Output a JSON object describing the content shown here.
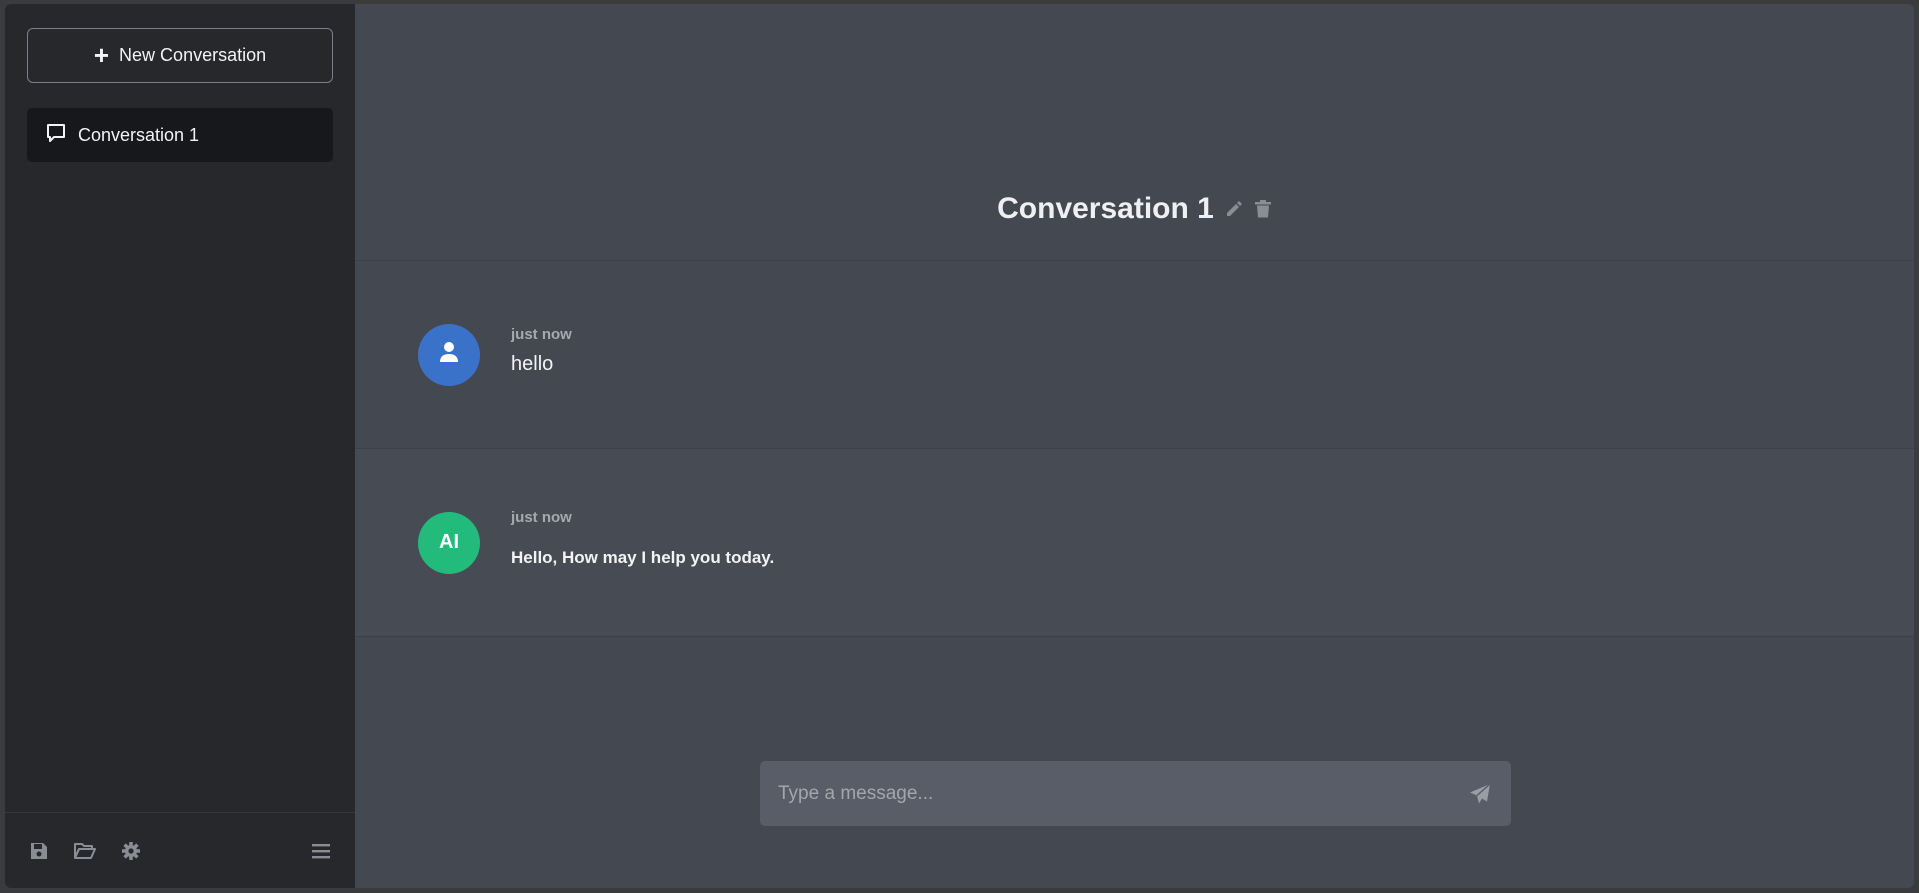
{
  "sidebar": {
    "new_conversation_label": "New Conversation",
    "conversations": [
      {
        "label": "Conversation 1"
      }
    ],
    "footer_icons": [
      "save-icon",
      "folder-open-icon",
      "gear-icon",
      "menu-icon"
    ]
  },
  "header": {
    "title": "Conversation 1",
    "icons": [
      "pencil-icon",
      "trash-icon"
    ]
  },
  "messages": [
    {
      "role": "user",
      "avatar": "user-icon",
      "time": "just now",
      "text": "hello"
    },
    {
      "role": "ai",
      "avatar_text": "AI",
      "time": "just now",
      "text": "Hello, How may I help you today."
    }
  ],
  "composer": {
    "placeholder": "Type a message...",
    "value": "",
    "send_icon": "send-icon"
  },
  "colors": {
    "sidebar_bg": "#26282c",
    "main_bg": "#444850",
    "user_avatar": "#3b72c9",
    "ai_avatar": "#22bb7c",
    "active_item_bg": "#17181b"
  }
}
